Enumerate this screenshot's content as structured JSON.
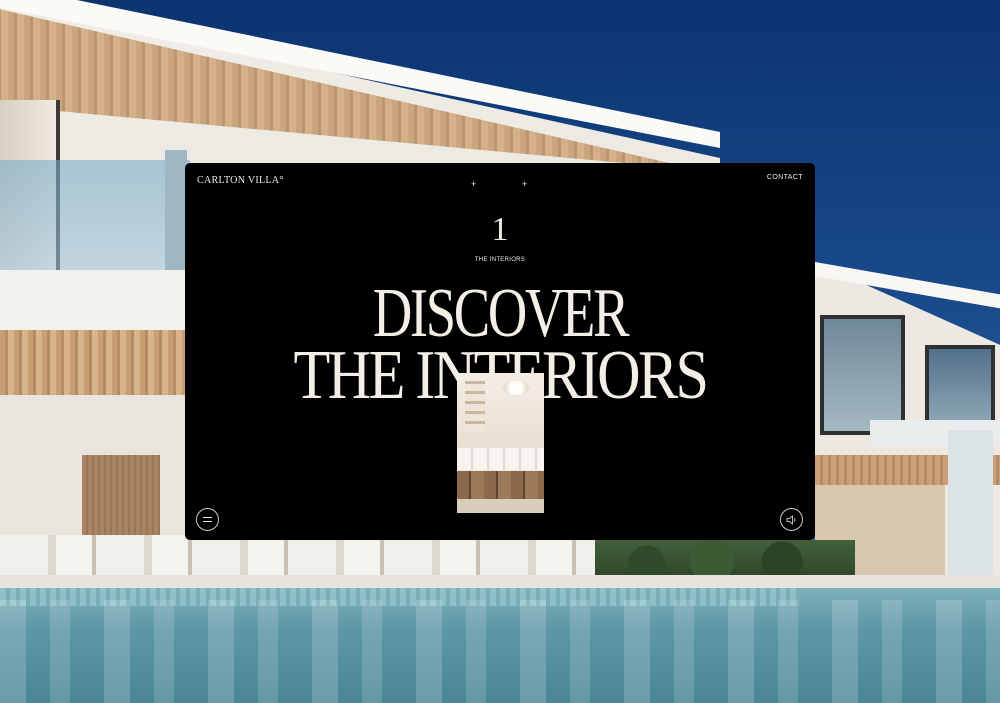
{
  "brand": {
    "logo_text": "CARLTON VILLA°"
  },
  "nav": {
    "contact_label": "CONTACT"
  },
  "chapter": {
    "number": "1",
    "label": "THE INTERIORS",
    "ornament": "+"
  },
  "headline": {
    "line1": "DISCOVER",
    "line2": "THE INTERIORS"
  },
  "controls": {
    "menu_icon": "menu-icon",
    "sound_icon": "speaker-icon"
  },
  "colors": {
    "panel": "#000000",
    "text": "#f4efe6",
    "sky": "#0b3470",
    "pool": "#5e97a6"
  }
}
